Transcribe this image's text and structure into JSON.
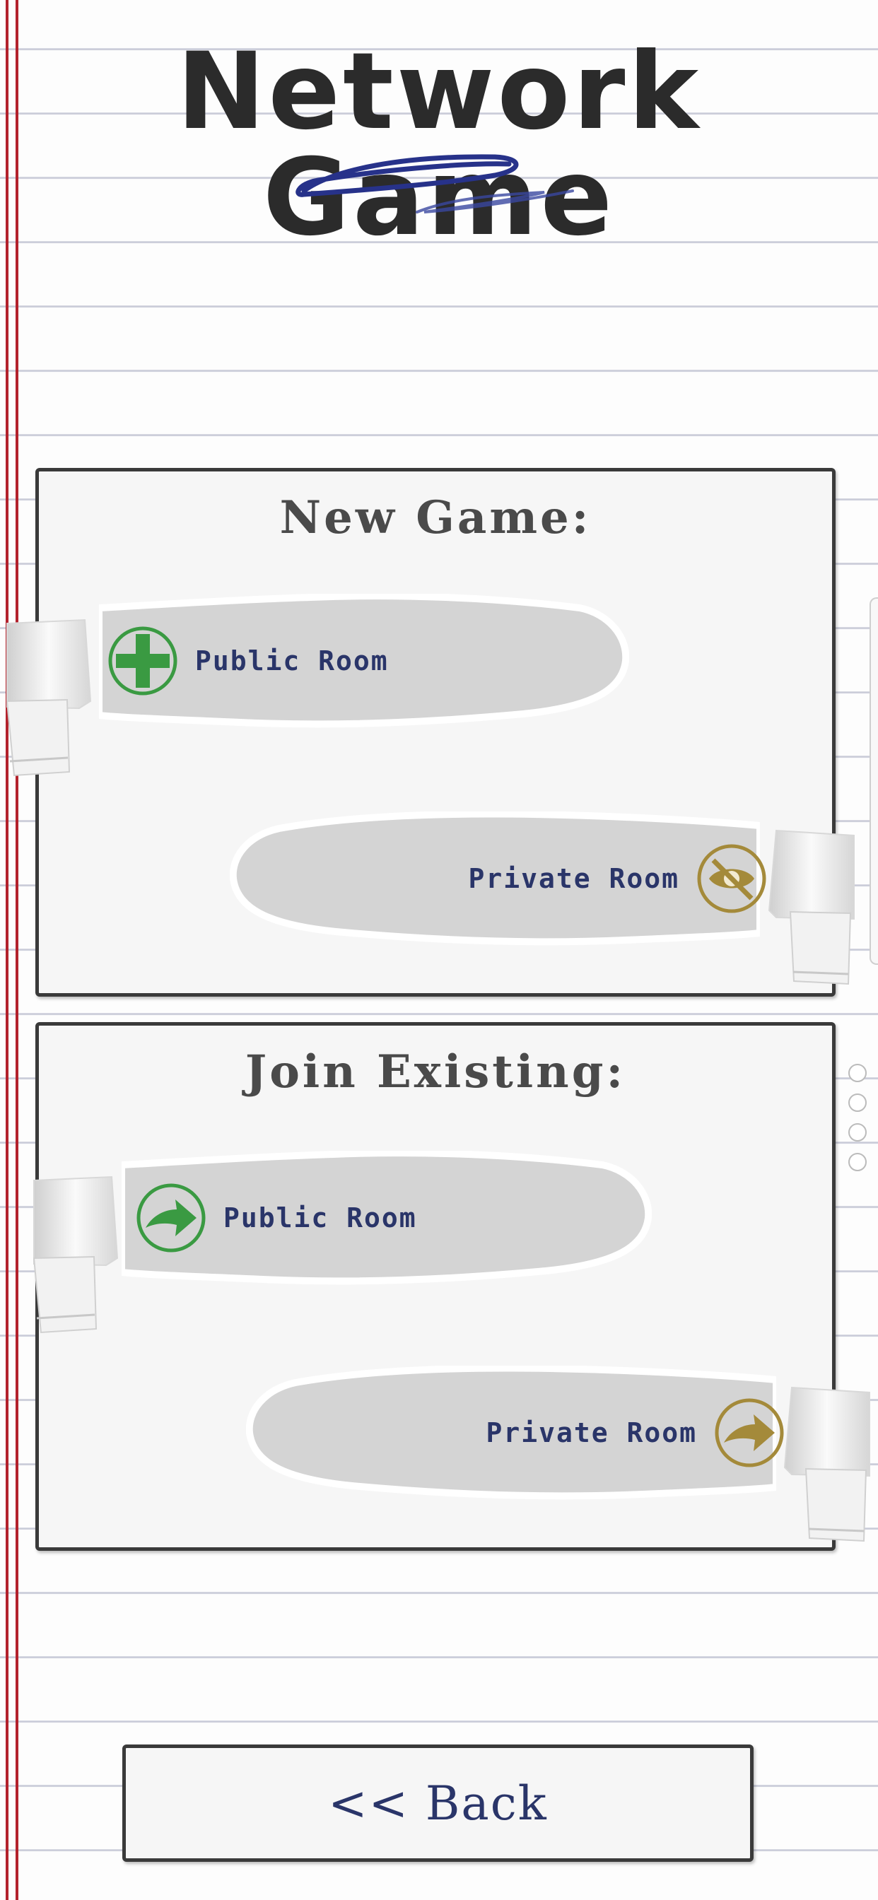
{
  "title": "Network Game",
  "new_game": {
    "heading": "New Game:",
    "public_label": "Public Room",
    "private_label": "Private Room",
    "public_icon": "plus-icon",
    "private_icon": "eye-off-icon"
  },
  "join_existing": {
    "heading": "Join Existing:",
    "public_label": "Public Room",
    "private_label": "Private Room",
    "public_icon": "arrow-right-icon",
    "private_icon": "arrow-right-icon"
  },
  "back_label": "<< Back",
  "colors": {
    "paper": "#fdfdfd",
    "rule_line": "#c9cbd8",
    "margin_line": "#b3222c",
    "ink_dark": "#2b2b2b",
    "button_text": "#2a3569",
    "green_stamp": "#3a9a42",
    "gold_stamp": "#a48a3a",
    "scribble": "#27328a"
  }
}
